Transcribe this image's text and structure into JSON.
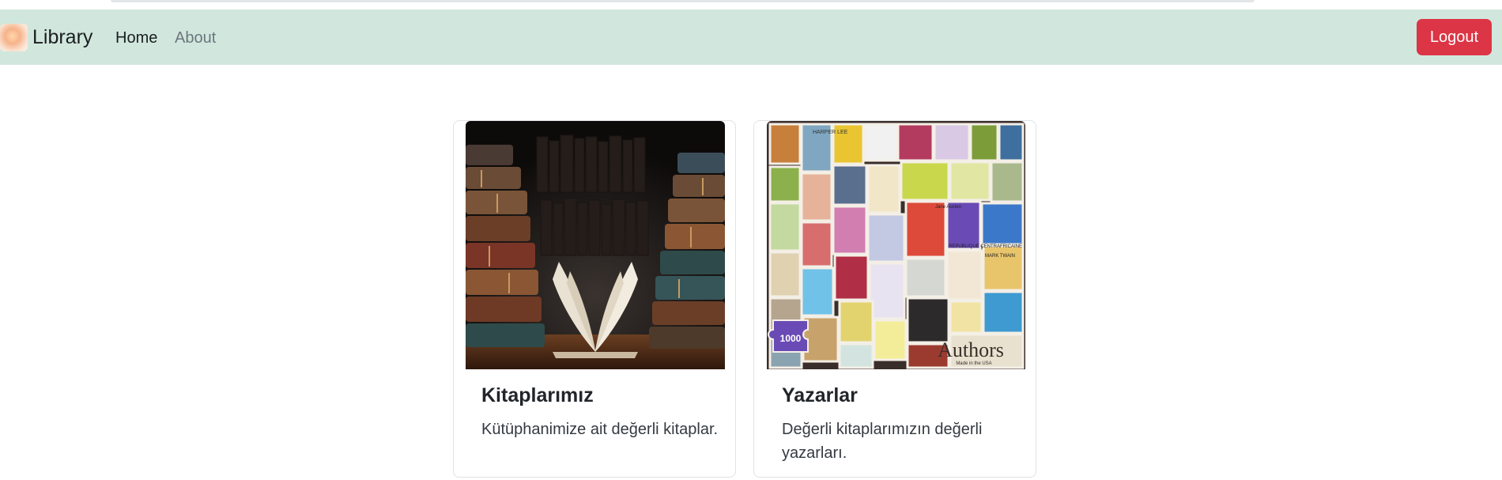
{
  "navbar": {
    "brand": "Library",
    "links": {
      "home": "Home",
      "about": "About"
    },
    "logout_label": "Logout",
    "colors": {
      "background": "#d1e7dd",
      "logout": "#dc3545",
      "active_link": "#1b1e21",
      "inactive_link": "#6c757d"
    }
  },
  "cards": [
    {
      "title": "Kitaplarımız",
      "text": "Kütüphanimize ait değerli kitaplar.",
      "image": "old-books-icon"
    },
    {
      "title": "Yazarlar",
      "text": "Değerli kitaplarımızın değerli yazarları.",
      "image": "author-stamps-icon"
    }
  ],
  "stamps": {
    "badge": "1000",
    "caption": "Authors",
    "caption_sub": "Made in the USA",
    "label_1": "REPUBLIQUE CENTRAFRICAINE",
    "label_2": "HARPER LEE",
    "label_3": "MARK TWAIN",
    "label_4": "Jane Austen"
  }
}
